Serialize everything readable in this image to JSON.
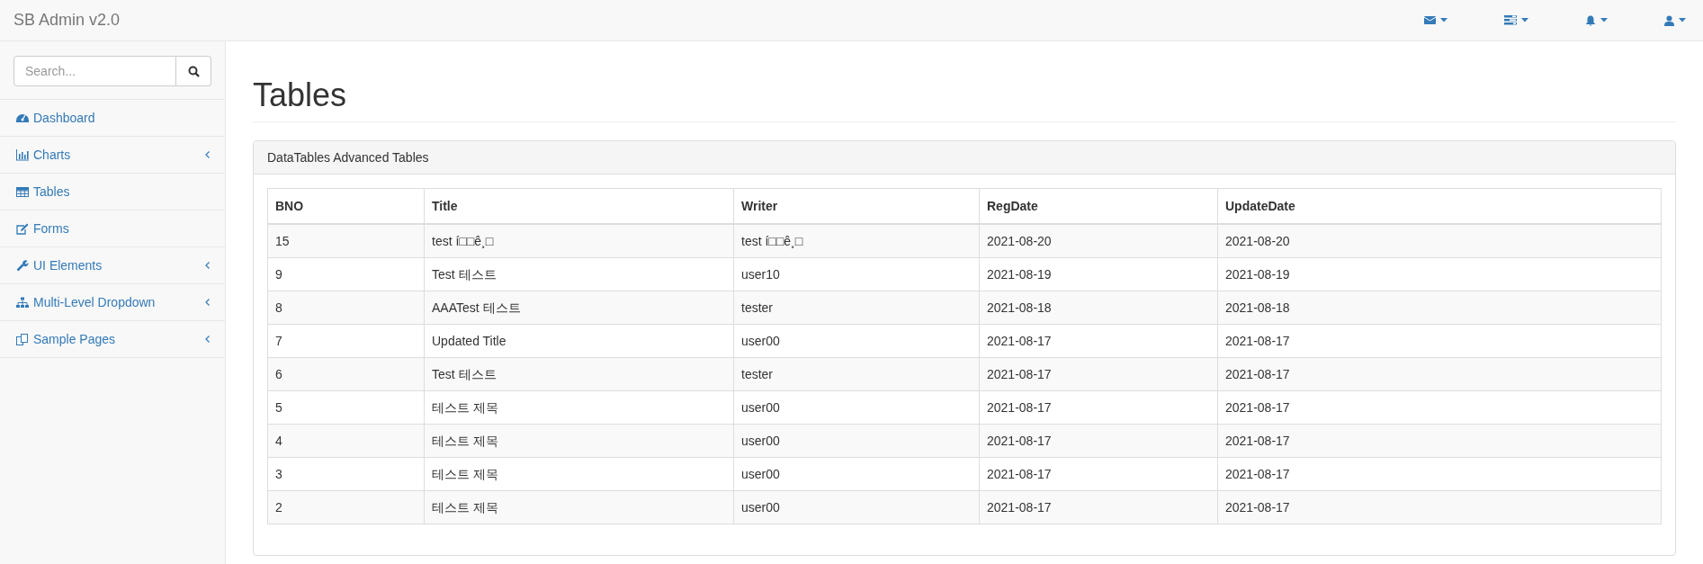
{
  "navbar": {
    "brand": "SB Admin v2.0"
  },
  "sidebar": {
    "search": {
      "placeholder": "Search..."
    },
    "items": [
      {
        "label": "Dashboard",
        "has_submenu": false
      },
      {
        "label": "Charts",
        "has_submenu": true
      },
      {
        "label": "Tables",
        "has_submenu": false
      },
      {
        "label": "Forms",
        "has_submenu": false
      },
      {
        "label": "UI Elements",
        "has_submenu": true
      },
      {
        "label": "Multi-Level Dropdown",
        "has_submenu": true
      },
      {
        "label": "Sample Pages",
        "has_submenu": true
      }
    ]
  },
  "page": {
    "title": "Tables"
  },
  "panel": {
    "heading": "DataTables Advanced Tables"
  },
  "table": {
    "columns": [
      "BNO",
      "Title",
      "Writer",
      "RegDate",
      "UpdateDate"
    ],
    "rows": [
      [
        "15",
        "test í□□ê¸□",
        "test í□□ê¸□",
        "2021-08-20",
        "2021-08-20"
      ],
      [
        "9",
        "Test 테스트",
        "user10",
        "2021-08-19",
        "2021-08-19"
      ],
      [
        "8",
        "AAATest 테스트",
        "tester",
        "2021-08-18",
        "2021-08-18"
      ],
      [
        "7",
        "Updated Title",
        "user00",
        "2021-08-17",
        "2021-08-17"
      ],
      [
        "6",
        "Test 테스트",
        "tester",
        "2021-08-17",
        "2021-08-17"
      ],
      [
        "5",
        "테스트 제목",
        "user00",
        "2021-08-17",
        "2021-08-17"
      ],
      [
        "4",
        "테스트 제목",
        "user00",
        "2021-08-17",
        "2021-08-17"
      ],
      [
        "3",
        "테스트 제목",
        "user00",
        "2021-08-17",
        "2021-08-17"
      ],
      [
        "2",
        "테스트 제목",
        "user00",
        "2021-08-17",
        "2021-08-17"
      ]
    ]
  }
}
